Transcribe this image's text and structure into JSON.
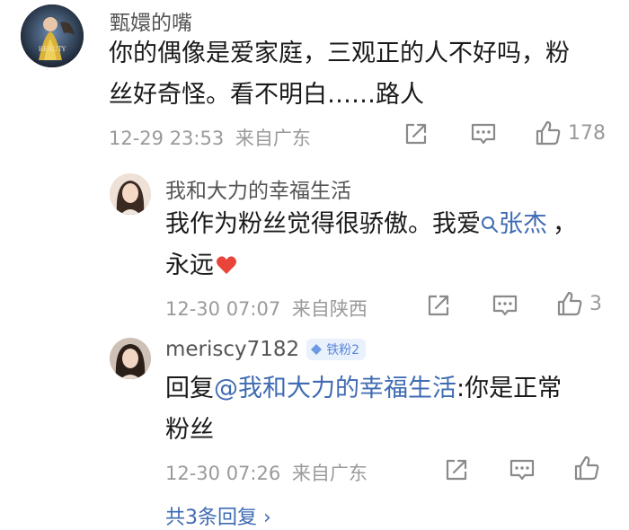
{
  "comments": [
    {
      "username": "甄嬛的嘴",
      "text_line1": "你的偶像是爱家庭，三观正的人不好吗，粉",
      "text_line2": "丝好奇怪。看不明白……路人",
      "timestamp": "12-29 23:53",
      "location": "来自广东",
      "like_count": "178",
      "avatar_icon": "beauty-and-the-beast-avatar"
    }
  ],
  "replies": [
    {
      "username": "我和大力的幸福生活",
      "text_line1_prefix": "我作为粉丝觉得很骄傲。我爱",
      "mention": "张杰",
      "text_line1_suffix": "，",
      "text_line2": "永远",
      "timestamp": "12-30 07:07",
      "location": "来自陕西",
      "like_count": "3"
    },
    {
      "username": "meriscy7182",
      "badge": "铁粉2",
      "reply_prefix": "回复",
      "reply_target": "@我和大力的幸福生活",
      "text_line1_suffix": ":你是正常",
      "text_line2": "粉丝",
      "timestamp": "12-30 07:26",
      "location": "来自广东",
      "like_count": ""
    }
  ],
  "more_replies": "共3条回复 ›",
  "colors": {
    "link": "#3f6bb3",
    "meta": "#9a9a9a",
    "heart": "#e8443a"
  }
}
